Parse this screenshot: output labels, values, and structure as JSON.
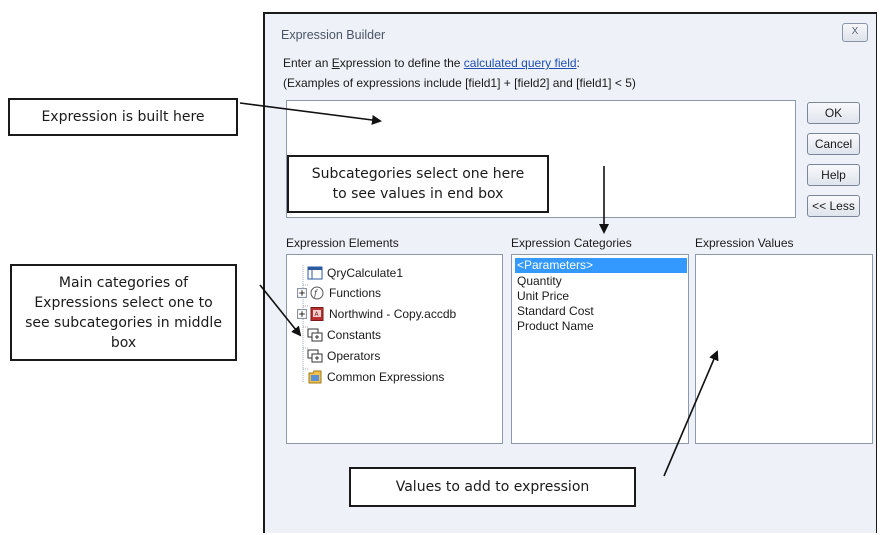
{
  "dialog": {
    "title": "Expression Builder",
    "close_label": "X",
    "instruction_prefix": "Enter an ",
    "instruction_underlined": "E",
    "instruction_middle": "xpression to define the ",
    "instruction_link": "calculated query field",
    "instruction_suffix": ":",
    "examples_text": "(Examples of expressions include [field1] + [field2] and [field1] < 5)"
  },
  "buttons": {
    "ok": "OK",
    "cancel": "Cancel",
    "help": "Help",
    "less": "<< Less"
  },
  "elements": {
    "header": "Expression Elements",
    "items": [
      {
        "label": "QryCalculate1",
        "icon": "query-icon"
      },
      {
        "label": "Functions",
        "icon": "function-icon"
      },
      {
        "label": "Northwind - Copy.accdb",
        "icon": "database-icon"
      },
      {
        "label": "Constants",
        "icon": "constants-icon"
      },
      {
        "label": "Operators",
        "icon": "operators-icon"
      },
      {
        "label": "Common Expressions",
        "icon": "common-expressions-icon"
      }
    ]
  },
  "categories": {
    "header": "Expression Categories",
    "items": [
      "<Parameters>",
      "Quantity",
      "Unit Price",
      "Standard Cost",
      "Product Name"
    ],
    "selected": "<Parameters>"
  },
  "values": {
    "header": "Expression Values"
  },
  "annotations": {
    "expression_built": "Expression is built here",
    "main_categories": "Main categories of Expressions select one to see subcategories in middle box",
    "subcategories": "Subcategories select one here to see values in end box",
    "values_to_add": "Values to add to expression"
  },
  "colors": {
    "dialog_bg": "#eef1f8",
    "selection": "#3399ff",
    "link": "#1f4fb5"
  }
}
